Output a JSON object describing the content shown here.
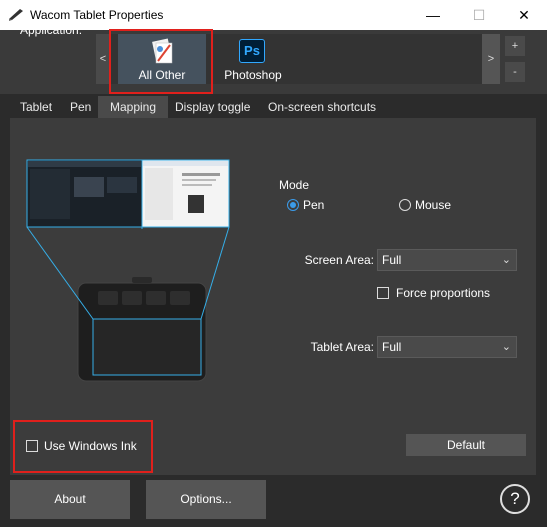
{
  "window": {
    "title": "Wacom Tablet Properties",
    "controls": {
      "minimize": "—",
      "maximize": "☐",
      "close": "✕"
    }
  },
  "application": {
    "label": "Application:",
    "scroll_left": "<",
    "scroll_right": ">",
    "add": "+",
    "remove": "-",
    "apps": [
      {
        "name": "All Other",
        "icon": "all-other-icon",
        "selected": true
      },
      {
        "name": "Photoshop",
        "icon": "photoshop-icon",
        "icon_text": "Ps",
        "selected": false
      }
    ]
  },
  "tabs": [
    {
      "label": "Tablet",
      "active": false
    },
    {
      "label": "Pen",
      "active": false
    },
    {
      "label": "Mapping",
      "active": true
    },
    {
      "label": "Display toggle",
      "active": false
    },
    {
      "label": "On-screen shortcuts",
      "active": false
    }
  ],
  "mapping": {
    "mode_label": "Mode",
    "mode_options": [
      {
        "label": "Pen",
        "selected": true
      },
      {
        "label": "Mouse",
        "selected": false
      }
    ],
    "screen_area_label": "Screen Area:",
    "screen_area_value": "Full",
    "force_proportions_label": "Force proportions",
    "force_proportions_checked": false,
    "tablet_area_label": "Tablet Area:",
    "tablet_area_value": "Full",
    "use_windows_ink_label": "Use Windows Ink",
    "use_windows_ink_checked": false,
    "default_button": "Default"
  },
  "footer": {
    "about_button": "About",
    "options_button": "Options...",
    "help_button": "?"
  },
  "colors": {
    "accent": "#3b9be8",
    "highlight_box": "#e0201c",
    "background": "#2b2b2b",
    "panel": "#3c3c3c"
  }
}
